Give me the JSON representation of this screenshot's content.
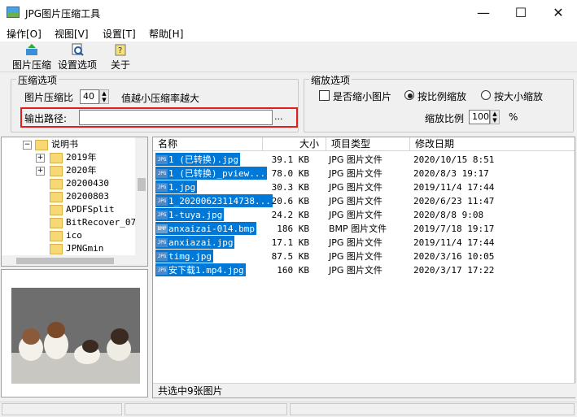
{
  "window": {
    "title": "JPG图片压缩工具",
    "minimize": "—",
    "maximize": "☐",
    "close": "✕"
  },
  "menu": [
    "操作[O]",
    "视图[V]",
    "设置[T]",
    "帮助[H]"
  ],
  "toolbar": {
    "compress": "图片压缩",
    "settings": "设置选项",
    "about": "关于"
  },
  "compress_group": {
    "legend": "压缩选项",
    "ratio_label": "图片压缩比",
    "ratio_value": "40",
    "ratio_hint": "值越小压缩率越大",
    "output_label": "输出路径:",
    "output_value": "",
    "browse": "..."
  },
  "scale_group": {
    "legend": "缩放选项",
    "shrink_label": "是否缩小图片",
    "shrink_checked": false,
    "by_ratio": "按比例缩放",
    "by_size": "按大小缩放",
    "ratio_label": "缩放比例",
    "ratio_value": "100",
    "ratio_unit": "%"
  },
  "tree": {
    "items": [
      {
        "label": "说明书",
        "expander": "−"
      },
      {
        "label": "2019年",
        "expander": "+"
      },
      {
        "label": "2020年",
        "expander": "+"
      },
      {
        "label": "20200430",
        "expander": ""
      },
      {
        "label": "20200803",
        "expander": ""
      },
      {
        "label": "APDFSplit",
        "expander": ""
      },
      {
        "label": "BitRecover_07-",
        "expander": ""
      },
      {
        "label": "ico",
        "expander": ""
      },
      {
        "label": "JPNGmin",
        "expander": ""
      }
    ]
  },
  "list": {
    "headers": {
      "name": "名称",
      "size": "大小",
      "type": "项目类型",
      "date": "修改日期"
    },
    "rows": [
      {
        "icon": "JPG",
        "name": "1 (已转换).jpg",
        "size": "39.1 KB",
        "type": "JPG 图片文件",
        "date": "2020/10/15 8:51"
      },
      {
        "icon": "JPG",
        "name": "1 (已转换)_pview...",
        "size": "78.0 KB",
        "type": "JPG 图片文件",
        "date": "2020/8/3 19:17"
      },
      {
        "icon": "JPG",
        "name": "1.jpg",
        "size": "30.3 KB",
        "type": "JPG 图片文件",
        "date": "2019/11/4 17:44"
      },
      {
        "icon": "JPG",
        "name": "1_20200623114738...",
        "size": "20.6 KB",
        "type": "JPG 图片文件",
        "date": "2020/6/23 11:47"
      },
      {
        "icon": "JPG",
        "name": "1-tuya.jpg",
        "size": "24.2 KB",
        "type": "JPG 图片文件",
        "date": "2020/8/8 9:08"
      },
      {
        "icon": "BMP",
        "name": "anxaizai-014.bmp",
        "size": "186 KB",
        "type": "BMP 图片文件",
        "date": "2019/7/18 19:17"
      },
      {
        "icon": "JPG",
        "name": "anxiazai.jpg",
        "size": "17.1 KB",
        "type": "JPG 图片文件",
        "date": "2019/11/4 17:44"
      },
      {
        "icon": "JPG",
        "name": "timg.jpg",
        "size": "87.5 KB",
        "type": "JPG 图片文件",
        "date": "2020/3/16 10:05"
      },
      {
        "icon": "JPG",
        "name": "安下载1.mp4.jpg",
        "size": "160 KB",
        "type": "JPG 图片文件",
        "date": "2020/3/17 17:22"
      }
    ]
  },
  "status": "共选中9张图片",
  "colors": {
    "selection": "#0078d7",
    "highlight_box": "#e02020",
    "folder": "#f8d775"
  }
}
